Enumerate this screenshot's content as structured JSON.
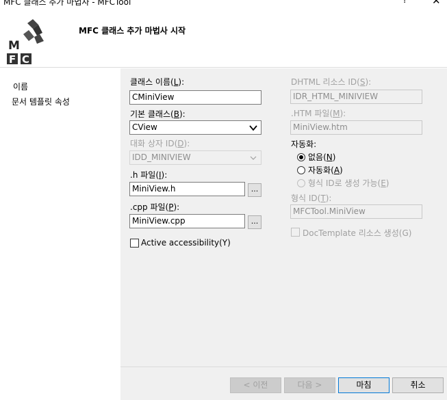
{
  "window": {
    "title": "MFC 클래스 추가 마법사 - MFCTool",
    "help_label": "?",
    "close_label": "✕"
  },
  "header": {
    "title": "MFC 클래스 추가 마법사 시작",
    "logo_letters": [
      "M",
      "F",
      "C"
    ]
  },
  "nav": {
    "items": [
      {
        "label": "이름",
        "selected": true
      },
      {
        "label": "문서 템플릿 속성",
        "selected": false
      }
    ]
  },
  "form": {
    "class_name_label": "클래스 이름(",
    "class_name_key": "L",
    "class_name_value": "CMiniView",
    "base_class_label": "기본 클래스(",
    "base_class_key": "B",
    "base_class_value": "CView",
    "dialog_id_label": "대화 상자 ID(",
    "dialog_id_key": "D",
    "dialog_id_value": "IDD_MINIVIEW",
    "h_file_label": ".h 파일(",
    "h_file_key": "I",
    "h_file_value": "MiniView.h",
    "cpp_file_label": ".cpp 파일(",
    "cpp_file_key": "P",
    "cpp_file_value": "MiniView.cpp",
    "browse_label": "...",
    "active_accessibility_label": "Active accessibility(Y)",
    "active_accessibility_checked": false,
    "dhtml_id_label": "DHTML 리소스 ID(",
    "dhtml_id_key": "S",
    "dhtml_id_value": "IDR_HTML_MINIVIEW",
    "htm_file_label": ".HTM 파일(",
    "htm_file_key": "M",
    "htm_file_value": "MiniView.htm",
    "automation_label": "자동화:",
    "automation_options": [
      {
        "label": "없음(",
        "key": "N",
        "checked": true,
        "disabled": false
      },
      {
        "label": "자동화(",
        "key": "A",
        "checked": false,
        "disabled": false
      },
      {
        "label": "형식 ID로 생성 가능(",
        "key": "E",
        "checked": false,
        "disabled": true
      }
    ],
    "type_id_label": "형식 ID(",
    "type_id_key": "T",
    "type_id_value": "MFCTool.MiniView",
    "doctemplate_label": "DocTemplate 리소스 생성(G)"
  },
  "footer": {
    "prev_label": "< 이전",
    "next_label": "다음 >",
    "finish_label": "마침",
    "cancel_label": "취소"
  },
  "colors": {
    "panel_bg": "#f0f0f0",
    "disabled_text": "#a0a0a0",
    "focus_border": "#0078d7"
  }
}
